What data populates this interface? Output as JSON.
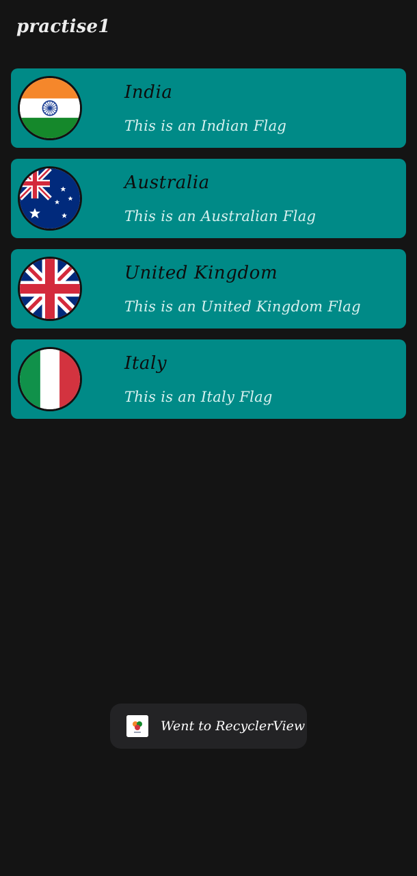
{
  "app": {
    "title": "practise1"
  },
  "colors": {
    "background": "#141414",
    "card": "#008a87",
    "toast": "#232325"
  },
  "countries": [
    {
      "name": "India",
      "description": "This is an Indian Flag",
      "flag_icon": "india-flag-icon"
    },
    {
      "name": "Australia",
      "description": "This is an Australian Flag",
      "flag_icon": "australia-flag-icon"
    },
    {
      "name": "United Kingdom",
      "description": "This is an United Kingdom Flag",
      "flag_icon": "uk-flag-icon"
    },
    {
      "name": "Italy",
      "description": "This is an Italy Flag",
      "flag_icon": "italy-flag-icon"
    }
  ],
  "toast": {
    "message": "Went to RecyclerView",
    "icon": "app-icon"
  }
}
